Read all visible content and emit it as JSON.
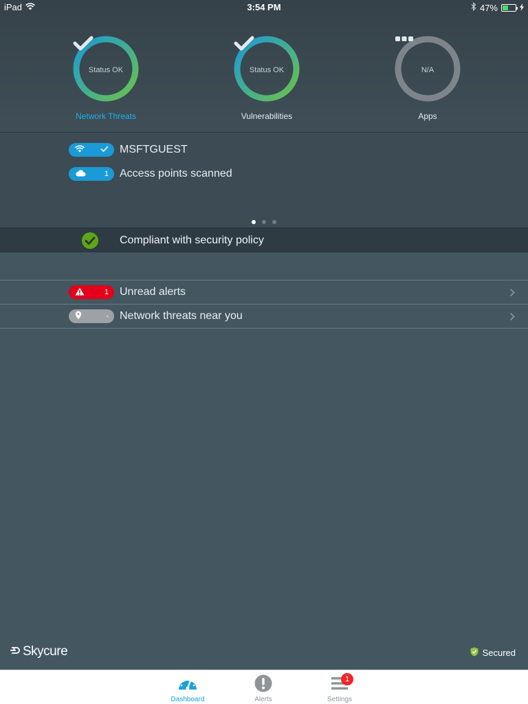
{
  "status_bar": {
    "device": "iPad",
    "time": "3:54 PM",
    "battery_percent": "47%",
    "battery_level": 0.47,
    "icons": [
      "wifi-icon",
      "bluetooth-icon",
      "battery-icon",
      "charging-icon"
    ]
  },
  "gauges": [
    {
      "status": "Status OK",
      "label": "Network Threats",
      "icon": "checkmark-icon",
      "state": "ok",
      "active": true
    },
    {
      "status": "Status OK",
      "label": "Vulnerabilities",
      "icon": "checkmark-icon",
      "state": "ok",
      "active": false
    },
    {
      "status": "N/A",
      "label": "Apps",
      "icon": "ellipsis-icon",
      "state": "na",
      "active": false
    }
  ],
  "network": {
    "wifi_name": "MSFTGUEST",
    "wifi_icon": "wifi-icon",
    "wifi_status_icon": "checkmark-icon",
    "access_points_count": "1",
    "access_points_label": "Access points scanned",
    "access_points_icon": "cloud-icon",
    "page_count": 3,
    "current_page": 1
  },
  "compliance": {
    "text": "Compliant with security policy",
    "icon": "check-circle-icon"
  },
  "list": [
    {
      "label": "Unread alerts",
      "count": "1",
      "icon": "warning-icon",
      "color": "#e2001a"
    },
    {
      "label": "Network threats near you",
      "count": "-",
      "icon": "location-pin-icon",
      "color": "#9da2a6"
    }
  ],
  "footer": {
    "brand": "Skycure",
    "secured_label": "Secured",
    "secured_icon": "shield-check-icon"
  },
  "tabs": [
    {
      "label": "Dashboard",
      "icon": "gauge-icon",
      "active": true
    },
    {
      "label": "Alerts",
      "icon": "exclamation-circle-icon",
      "active": false
    },
    {
      "label": "Settings",
      "icon": "menu-icon",
      "active": false,
      "badge": "1"
    }
  ],
  "colors": {
    "accent": "#1bb4e5",
    "ring_ok_start": "#1a9ad6",
    "ring_ok_end": "#6cc24a",
    "ring_na": "#7d858a",
    "alert_red": "#e2001a",
    "compliance_green": "#5ea51a"
  }
}
